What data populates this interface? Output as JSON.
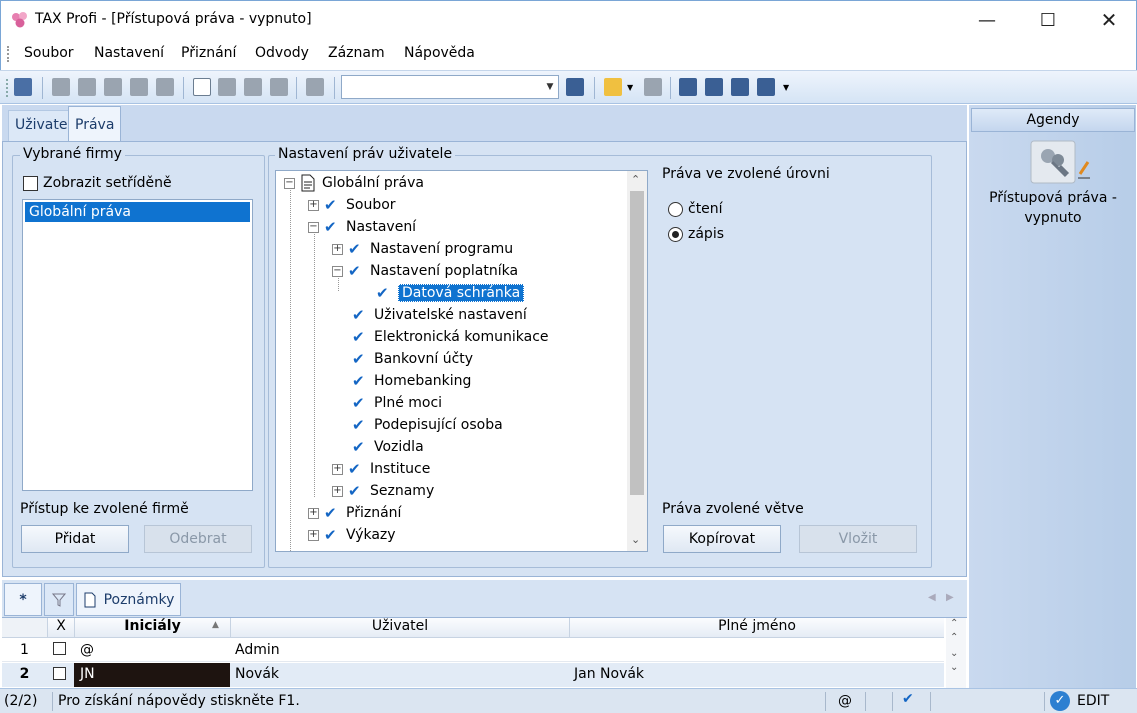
{
  "window": {
    "title": "TAX Profi - [Přístupová práva - vypnuto]"
  },
  "menu": [
    "Soubor",
    "Nastavení",
    "Přiznání",
    "Odvody",
    "Záznam",
    "Nápověda"
  ],
  "tabs": {
    "uzivatel": "Uživatel",
    "prava": "Práva"
  },
  "firms": {
    "label": "Vybrané firmy",
    "sorted_label": "Zobrazit setříděně",
    "items": [
      "Globální práva"
    ],
    "access_label": "Přístup ke zvolené firmě",
    "add": "Přidat",
    "remove": "Odebrat"
  },
  "rights": {
    "label": "Nastavení práv uživatele",
    "tree": [
      "Globální práva",
      "Soubor",
      "Nastavení",
      "Nastavení programu",
      "Nastavení poplatníka",
      "Datová schránka",
      "Uživatelské nastavení",
      "Elektronická komunikace",
      "Bankovní účty",
      "Homebanking",
      "Plné moci",
      "Podepisující osoba",
      "Vozidla",
      "Instituce",
      "Seznamy",
      "Přiznání",
      "Výkazy"
    ],
    "level_label": "Práva ve zvolené úrovni",
    "read": "čtení",
    "write": "zápis",
    "selected_level": "write",
    "branch_label": "Práva zvolené větve",
    "copy": "Kopírovat",
    "paste": "Vložit"
  },
  "agendy": {
    "title": "Agendy",
    "item": "Přístupová práva - vypnuto"
  },
  "bottom": {
    "tab_star": "*",
    "tab_notes": "Poznámky",
    "columns": [
      "X",
      "Iniciály",
      "Uživatel",
      "Plné jméno"
    ],
    "rows": [
      {
        "n": "1",
        "initials": "@",
        "user": "Admin",
        "full": ""
      },
      {
        "n": "2",
        "initials": "JN",
        "user": "Novák",
        "full": "Jan Novák"
      }
    ]
  },
  "status": {
    "count": "(2/2)",
    "help": "Pro získání nápovědy stiskněte F1.",
    "at": "@",
    "mode": "EDIT"
  },
  "colors": {
    "accent": "#0f73d0",
    "panel": "#d6e3f3",
    "check": "#1466c4"
  }
}
